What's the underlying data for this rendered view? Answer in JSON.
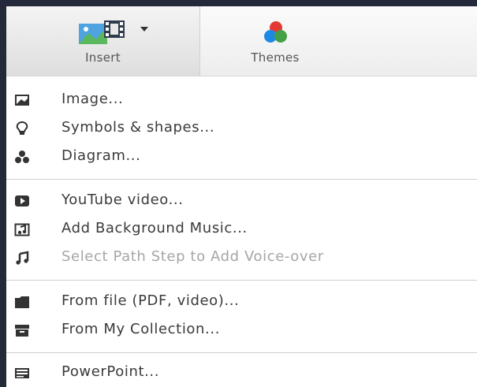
{
  "toolbar": {
    "insert_label": "Insert",
    "themes_label": "Themes"
  },
  "menu": {
    "groups": [
      [
        {
          "label": "Image...",
          "icon": "image-icon",
          "enabled": true
        },
        {
          "label": "Symbols & shapes...",
          "icon": "lightbulb-icon",
          "enabled": true
        },
        {
          "label": "Diagram...",
          "icon": "diagram-icon",
          "enabled": true
        }
      ],
      [
        {
          "label": "YouTube video...",
          "icon": "youtube-icon",
          "enabled": true
        },
        {
          "label": "Add Background Music...",
          "icon": "background-music-icon",
          "enabled": true
        },
        {
          "label": "Select Path Step to Add Voice-over",
          "icon": "music-note-icon",
          "enabled": false
        }
      ],
      [
        {
          "label": "From file (PDF, video)...",
          "icon": "folder-icon",
          "enabled": true
        },
        {
          "label": "From My Collection...",
          "icon": "collection-icon",
          "enabled": true
        }
      ],
      [
        {
          "label": "PowerPoint...",
          "icon": "powerpoint-icon",
          "enabled": true
        }
      ]
    ]
  },
  "colors": {
    "menu_text": "#3a3a3a",
    "disabled_text": "#a6a6a6",
    "header_dark": "#23283a"
  }
}
